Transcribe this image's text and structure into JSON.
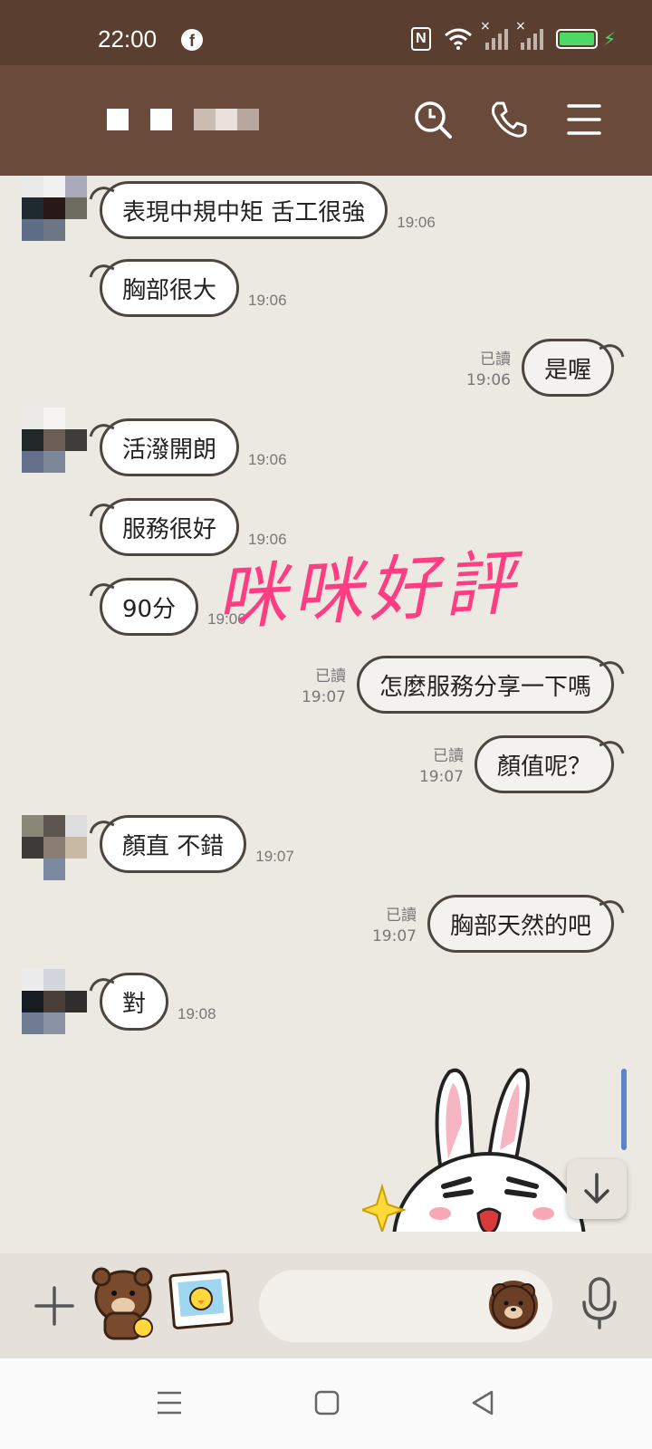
{
  "status_bar": {
    "time": "22:00"
  },
  "header": {
    "title": ""
  },
  "messages": [
    {
      "side": "left",
      "text": "表現中規中矩  舌工很強",
      "time": "19:06"
    },
    {
      "side": "left",
      "text": "胸部很大",
      "time": "19:06"
    },
    {
      "side": "right",
      "text": "是喔",
      "read": "已讀",
      "time": "19:06"
    },
    {
      "side": "left",
      "text": "活潑開朗",
      "time": "19:06"
    },
    {
      "side": "left",
      "text": "服務很好",
      "time": "19:06"
    },
    {
      "side": "left",
      "text": "90分",
      "time": "19:06"
    },
    {
      "side": "right",
      "text": "怎麼服務分享一下嗎",
      "read": "已讀",
      "time": "19:07"
    },
    {
      "side": "right",
      "text": "顏值呢？",
      "read": "已讀",
      "time": "19:07"
    },
    {
      "side": "left",
      "text": "顏直 不錯",
      "time": "19:07"
    },
    {
      "side": "right",
      "text": "胸部天然的吧",
      "read": "已讀",
      "time": "19:07"
    },
    {
      "side": "left",
      "text": "對",
      "time": "19:08"
    }
  ],
  "watermark": "咪咪好評",
  "input": {
    "placeholder": ""
  },
  "colors": {
    "header": "#6a4a3b",
    "status_bar": "#5a3f31",
    "chat_bg": "#ece8e2",
    "watermark": "#ff3d82"
  },
  "icons": [
    "search-icon",
    "phone-icon",
    "menu-icon",
    "plus-icon",
    "sticker-icon",
    "photo-icon",
    "emoji-icon",
    "mic-icon",
    "scroll-down-icon"
  ]
}
